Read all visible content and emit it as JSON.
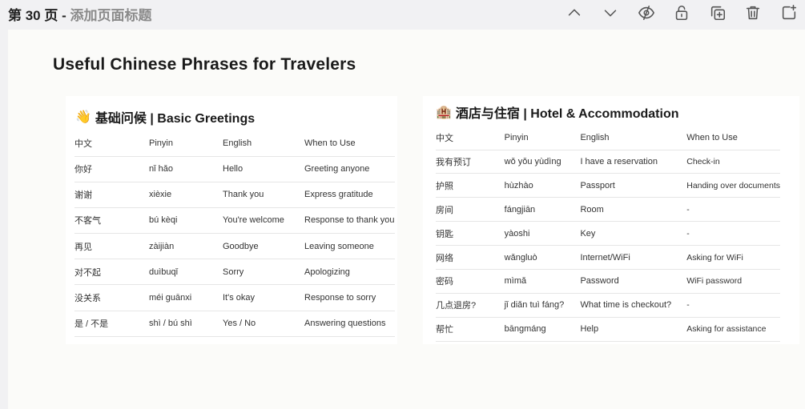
{
  "topbar": {
    "page_number": "第 30 页",
    "separator": " - ",
    "title_placeholder": "添加页面标题",
    "icons": [
      "chevron-up-icon",
      "chevron-down-icon",
      "eye-off-icon",
      "lock-icon",
      "duplicate-icon",
      "trash-icon",
      "add-page-icon"
    ]
  },
  "slide": {
    "title": "Useful Chinese Phrases for Travelers",
    "greetings": {
      "emoji": "👋",
      "title": "基础问候 | Basic Greetings",
      "headers": [
        "中文",
        "Pinyin",
        "English",
        "When to Use"
      ],
      "rows": [
        [
          "你好",
          "nǐ hǎo",
          "Hello",
          "Greeting anyone"
        ],
        [
          "谢谢",
          "xièxie",
          "Thank you",
          "Express gratitude"
        ],
        [
          "不客气",
          "bú kèqi",
          "You're welcome",
          "Response to thank you"
        ],
        [
          "再见",
          "zàijiàn",
          "Goodbye",
          "Leaving someone"
        ],
        [
          "对不起",
          "duìbuqǐ",
          "Sorry",
          "Apologizing"
        ],
        [
          "没关系",
          "méi guānxi",
          "It's okay",
          "Response to sorry"
        ],
        [
          "是 / 不是",
          "shì / bú shì",
          "Yes / No",
          "Answering questions"
        ]
      ]
    },
    "hotel": {
      "emoji": "🏨",
      "title": "酒店与住宿 | Hotel & Accommodation",
      "headers": [
        "中文",
        "Pinyin",
        "English",
        "When to Use"
      ],
      "rows": [
        [
          "我有预订",
          "wǒ yǒu yùdìng",
          "I have a reservation",
          "Check-in"
        ],
        [
          "护照",
          "hùzhào",
          "Passport",
          "Handing over documents"
        ],
        [
          "房间",
          "fángjiān",
          "Room",
          "-"
        ],
        [
          "钥匙",
          "yàoshi",
          "Key",
          "-"
        ],
        [
          "网络",
          "wǎngluò",
          "Internet/WiFi",
          "Asking for WiFi"
        ],
        [
          "密码",
          "mìmǎ",
          "Password",
          "WiFi password"
        ],
        [
          "几点退房?",
          "jǐ diǎn tuì fáng?",
          "What time is checkout?",
          "-"
        ],
        [
          "帮忙",
          "bāngmáng",
          "Help",
          "Asking for assistance"
        ]
      ]
    }
  }
}
